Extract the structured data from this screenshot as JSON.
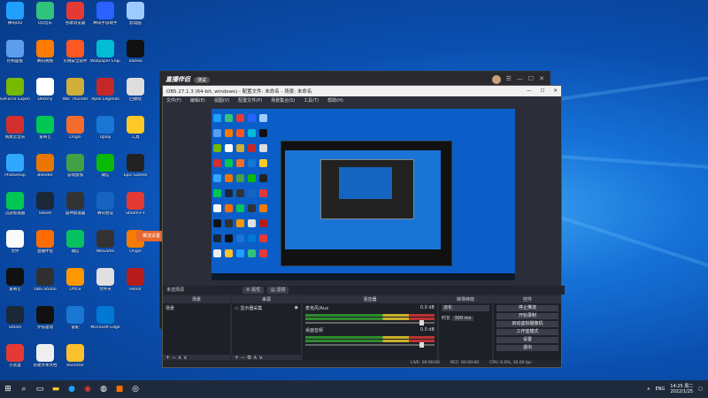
{
  "desktop_icons": [
    {
      "name": "腾讯QQ",
      "color": "#1fa0ff"
    },
    {
      "name": "QQ音乐",
      "color": "#31c27c"
    },
    {
      "name": "谷歌浏览器",
      "color": "#e53935"
    },
    {
      "name": "腾讯手游助手",
      "color": "#2962ff"
    },
    {
      "name": "此电脑",
      "color": "#9ecbff"
    },
    {
      "name": "控制面板",
      "color": "#5c9ded"
    },
    {
      "name": "腾讯视频",
      "color": "#ff7a00"
    },
    {
      "name": "火绒安全软件",
      "color": "#ff5722"
    },
    {
      "name": "Wallpaper Engine",
      "color": "#00bcd4"
    },
    {
      "name": "ToDesk",
      "color": "#111"
    },
    {
      "name": "GeForce Experience",
      "color": "#76b900"
    },
    {
      "name": "Destiny",
      "color": "#fff"
    },
    {
      "name": "War Thunder",
      "color": "#cfae3a"
    },
    {
      "name": "Apex Legends",
      "color": "#c62828"
    },
    {
      "name": "回收站",
      "color": "#ddd"
    },
    {
      "name": "网易云音乐",
      "color": "#d32f2f"
    },
    {
      "name": "爱奇艺",
      "color": "#00c853"
    },
    {
      "name": "Origin",
      "color": "#f56c2d"
    },
    {
      "name": "Uplay",
      "color": "#1976d2"
    },
    {
      "name": "工具",
      "color": "#ffca28"
    },
    {
      "name": "Photoshop",
      "color": "#31a8ff"
    },
    {
      "name": "Blender",
      "color": "#ea7600"
    },
    {
      "name": "游戏加加",
      "color": "#43a047"
    },
    {
      "name": "微信",
      "color": "#09bb07"
    },
    {
      "name": "Epic Games",
      "color": "#222"
    },
    {
      "name": "迅游加速器",
      "color": "#00c853"
    },
    {
      "name": "Steam",
      "color": "#1b2838"
    },
    {
      "name": "雷神加速器",
      "color": "#333"
    },
    {
      "name": "腾讯会议",
      "color": "#1565c0"
    },
    {
      "name": "Steam++",
      "color": "#e53935"
    },
    {
      "name": "文件",
      "color": "#fafafa"
    },
    {
      "name": "直播伴侣",
      "color": "#ff6d00"
    },
    {
      "name": "微信",
      "color": "#07c160"
    },
    {
      "name": "WeGame",
      "color": "#333"
    },
    {
      "name": "Origin",
      "color": "#f57c00"
    },
    {
      "name": "爱奇艺",
      "color": "#111"
    },
    {
      "name": "OBS Studio",
      "color": "#303030"
    },
    {
      "name": "Office",
      "color": "#ff9800"
    },
    {
      "name": "文件夹",
      "color": "#e0e0e0"
    },
    {
      "name": "Honor",
      "color": "#b71c1c"
    },
    {
      "name": "Steam",
      "color": "#1b2838"
    },
    {
      "name": "罗技驱动",
      "color": "#111"
    },
    {
      "name": "雷蛇",
      "color": "#1976d2"
    },
    {
      "name": "Microsoft Edge",
      "color": "#0078d4"
    },
    {
      "name": "小黑盒",
      "color": "#e53935"
    },
    {
      "name": "新建文本文档",
      "color": "#eee"
    },
    {
      "name": "Rockstar",
      "color": "#fbc02d"
    }
  ],
  "live_app": {
    "title": "直播伴侣",
    "badge": "测试",
    "side_label": "推流设置"
  },
  "obs": {
    "title": "OBS 27.1.3 (64-bit, windows) - 配置文件: 未命名 - 场景: 未命名",
    "menu": [
      "文件(F)",
      "编辑(E)",
      "视图(V)",
      "配置文件(P)",
      "场景集合(S)",
      "工具(T)",
      "帮助(H)"
    ],
    "source_bar": "未选择源",
    "tab_props": "属性",
    "tab_filters": "滤镜",
    "docks": {
      "scenes": "场景",
      "sources": "来源",
      "mixer": "混音器",
      "transitions": "转场特效",
      "controls": "控件"
    },
    "scene_item": "场景",
    "source_item": "显示器采集",
    "mixer": [
      {
        "name": "麦克风/Aux",
        "db": "0.0 dB"
      },
      {
        "name": "桌面音频",
        "db": "0.0 dB"
      }
    ],
    "transition": {
      "type": "淡化",
      "duration_label": "时长",
      "duration": "300 ms"
    },
    "controls": [
      "停止推流",
      "开始录制",
      "启动虚拟摄像机",
      "工作室模式",
      "设置",
      "退出"
    ],
    "status": [
      "LIVE: 00:00:00",
      "REC: 00:00:00",
      "CPU: 0.0%, 30.00 fps"
    ]
  },
  "taskbar": {
    "lang": "ENG",
    "time": "14:25 周二",
    "date": "2022/1/25"
  }
}
